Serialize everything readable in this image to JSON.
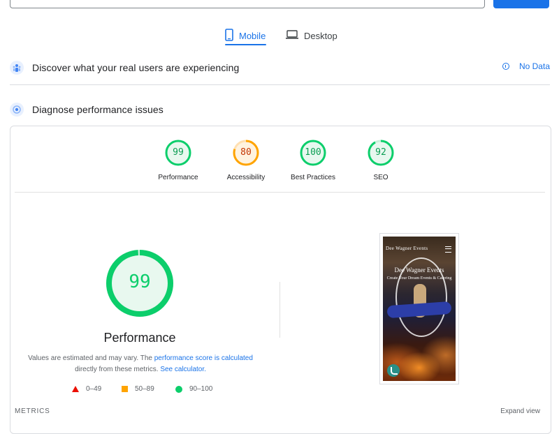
{
  "device_tabs": {
    "mobile": "Mobile",
    "desktop": "Desktop",
    "active": "Mobile"
  },
  "field_data": {
    "title": "Discover what your real users are experiencing",
    "status": "No Data"
  },
  "lab_data": {
    "title": "Diagnose performance issues"
  },
  "categories": [
    {
      "label": "Performance",
      "score": "99",
      "color": "#0cce6b"
    },
    {
      "label": "Accessibility",
      "score": "80",
      "color": "#ffa400"
    },
    {
      "label": "Best Practices",
      "score": "100",
      "color": "#0cce6b"
    },
    {
      "label": "SEO",
      "score": "92",
      "color": "#0cce6b"
    }
  ],
  "performance": {
    "score": "99",
    "title": "Performance",
    "explain_prefix": "Values are estimated and may vary. The ",
    "explain_link1": "performance score is calculated",
    "explain_middle": " directly from these metrics. ",
    "explain_link2": "See calculator.",
    "legend": [
      {
        "range": "0–49",
        "shape": "triangle",
        "color": "#eb0f00"
      },
      {
        "range": "50–89",
        "shape": "square",
        "color": "#ffa400"
      },
      {
        "range": "90–100",
        "shape": "circle",
        "color": "#0cce6b"
      }
    ]
  },
  "screenshot": {
    "brand": "Dee Wagner Events",
    "title": "Dee Wagner Events",
    "subtitle": "Create Your Dream Events & Catering"
  },
  "metrics": {
    "label": "METRICS",
    "expand": "Expand view"
  },
  "colors": {
    "accent": "#1a73e8",
    "pass": "#0cce6b",
    "average": "#ffa400",
    "fail": "#eb0f00"
  }
}
